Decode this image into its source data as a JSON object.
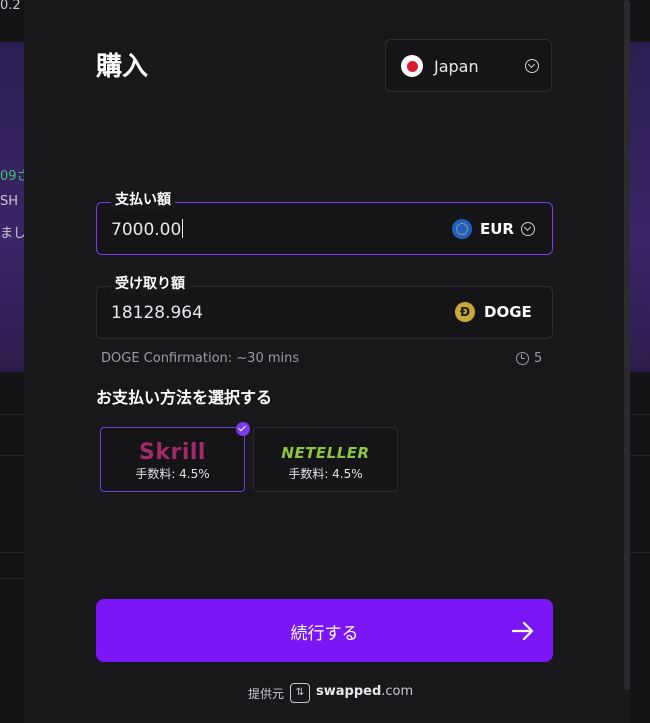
{
  "background": {
    "left_fragments": [
      "0.2",
      "09さ",
      "SH",
      "まし"
    ]
  },
  "modal": {
    "title": "購入",
    "country": {
      "label": "Japan",
      "flag_icon": "japan-flag-icon"
    },
    "pay_field": {
      "label": "支払い額",
      "value": "7000.00",
      "currency": "EUR",
      "currency_icon": "euro-icon"
    },
    "receive_field": {
      "label": "受け取り額",
      "value": "18128.964",
      "currency": "DOGE",
      "currency_icon": "dogecoin-icon"
    },
    "confirmation": {
      "text": "DOGE Confirmation: ~30 mins",
      "count": "5"
    },
    "payment_section_title": "お支払い方法を選択する",
    "payment_methods": [
      {
        "logo": "Skrill",
        "fee": "手数料: 4.5%",
        "selected": true,
        "color": "#a02a6b"
      },
      {
        "logo": "NETELLER",
        "fee": "手数料: 4.5%",
        "selected": false,
        "color": "#8dc63f"
      }
    ],
    "continue_button": {
      "label": "続行する"
    },
    "footer": {
      "provided_by": "提供元",
      "brand_main": "swapped",
      "brand_suffix": ".com"
    }
  },
  "colors": {
    "accent": "#7b16f6",
    "modal_bg": "#18181b"
  }
}
